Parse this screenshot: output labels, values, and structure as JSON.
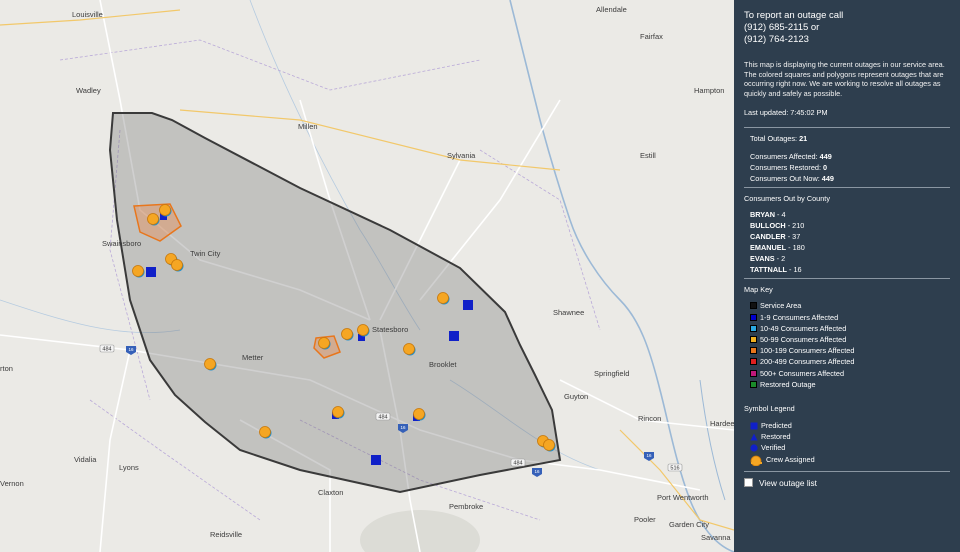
{
  "map": {
    "towns": [
      {
        "id": "louisville",
        "label": "Louisville"
      },
      {
        "id": "allendale",
        "label": "Allendale"
      },
      {
        "id": "fairfax",
        "label": "Fairfax"
      },
      {
        "id": "wadley",
        "label": "Wadley"
      },
      {
        "id": "hampton",
        "label": "Hampton"
      },
      {
        "id": "millen",
        "label": "Millen"
      },
      {
        "id": "sylvania",
        "label": "Sylvania"
      },
      {
        "id": "estill",
        "label": "Estill"
      },
      {
        "id": "swainsboro",
        "label": "Swainsboro"
      },
      {
        "id": "twin-city",
        "label": "Twin City"
      },
      {
        "id": "statesboro",
        "label": "Statesboro"
      },
      {
        "id": "shawnee",
        "label": "Shawnee"
      },
      {
        "id": "metter",
        "label": "Metter"
      },
      {
        "id": "brooklet",
        "label": "Brooklet"
      },
      {
        "id": "springfield",
        "label": "Springfield"
      },
      {
        "id": "guyton",
        "label": "Guyton"
      },
      {
        "id": "rincon",
        "label": "Rincon"
      },
      {
        "id": "hardee",
        "label": "Hardee"
      },
      {
        "id": "vidalia",
        "label": "Vidalia"
      },
      {
        "id": "lyons",
        "label": "Lyons"
      },
      {
        "id": "vernon",
        "label": "Vernon"
      },
      {
        "id": "claxton",
        "label": "Claxton"
      },
      {
        "id": "port-wentworth",
        "label": "Port Wentworth"
      },
      {
        "id": "pembroke",
        "label": "Pembroke"
      },
      {
        "id": "pooler",
        "label": "Pooler"
      },
      {
        "id": "garden-city",
        "label": "Garden City"
      },
      {
        "id": "reidsville",
        "label": "Reidsville"
      },
      {
        "id": "savannah",
        "label": "Savanna"
      },
      {
        "id": "orton",
        "label": "rton"
      }
    ],
    "shields": [
      "484",
      "484",
      "484",
      "16",
      "16",
      "16",
      "16",
      "516"
    ]
  },
  "panel": {
    "report_line1": "To report an outage call",
    "report_line2": "(912) 685-2115 or",
    "report_line3": "(912) 764-2123",
    "description": "This map is displaying the current outages in our service area. The colored squares and polygons represent outages that are occurring right now. We are working to resolve all outages as quickly and safely as possible.",
    "last_updated": "Last updated: 7:45:02 PM",
    "total_label": "Total Outages: ",
    "total_value": "21",
    "affected_label": "Consumers Affected: ",
    "affected_value": "449",
    "restored_label": "Consumers Restored: ",
    "restored_value": "0",
    "out_now_label": "Consumers Out Now: ",
    "out_now_value": "449",
    "county_heading": "Consumers Out by County",
    "counties": [
      {
        "name": "BRYAN",
        "count": " - 4"
      },
      {
        "name": "BULLOCH",
        "count": " - 210"
      },
      {
        "name": "CANDLER",
        "count": " - 37"
      },
      {
        "name": "EMANUEL",
        "count": " - 180"
      },
      {
        "name": "EVANS",
        "count": " - 2"
      },
      {
        "name": "TATTNALL",
        "count": " - 16"
      }
    ],
    "map_key_heading": "Map Key",
    "map_key": [
      {
        "label": "Service Area",
        "color": "#111111"
      },
      {
        "label": "1-9 Consumers Affected",
        "color": "#0000cc"
      },
      {
        "label": "10-49 Consumers Affected",
        "color": "#2aa8e0"
      },
      {
        "label": "50-99 Consumers Affected",
        "color": "#f0b020"
      },
      {
        "label": "100-199 Consumers Affected",
        "color": "#e8761c"
      },
      {
        "label": "200-499 Consumers Affected",
        "color": "#e02020"
      },
      {
        "label": "500+ Consumers Affected",
        "color": "#c0187a"
      },
      {
        "label": "Restored Outage",
        "color": "#1a8a2a"
      }
    ],
    "symbol_heading": "Symbol Legend",
    "symbols": [
      {
        "label": "Predicted",
        "icon": "square-icon"
      },
      {
        "label": "Restored",
        "icon": "triangle-icon"
      },
      {
        "label": "Verified",
        "icon": "circle-icon"
      },
      {
        "label": "Crew Assigned",
        "icon": "hardhat-icon"
      }
    ],
    "view_list_label": "View outage list"
  }
}
